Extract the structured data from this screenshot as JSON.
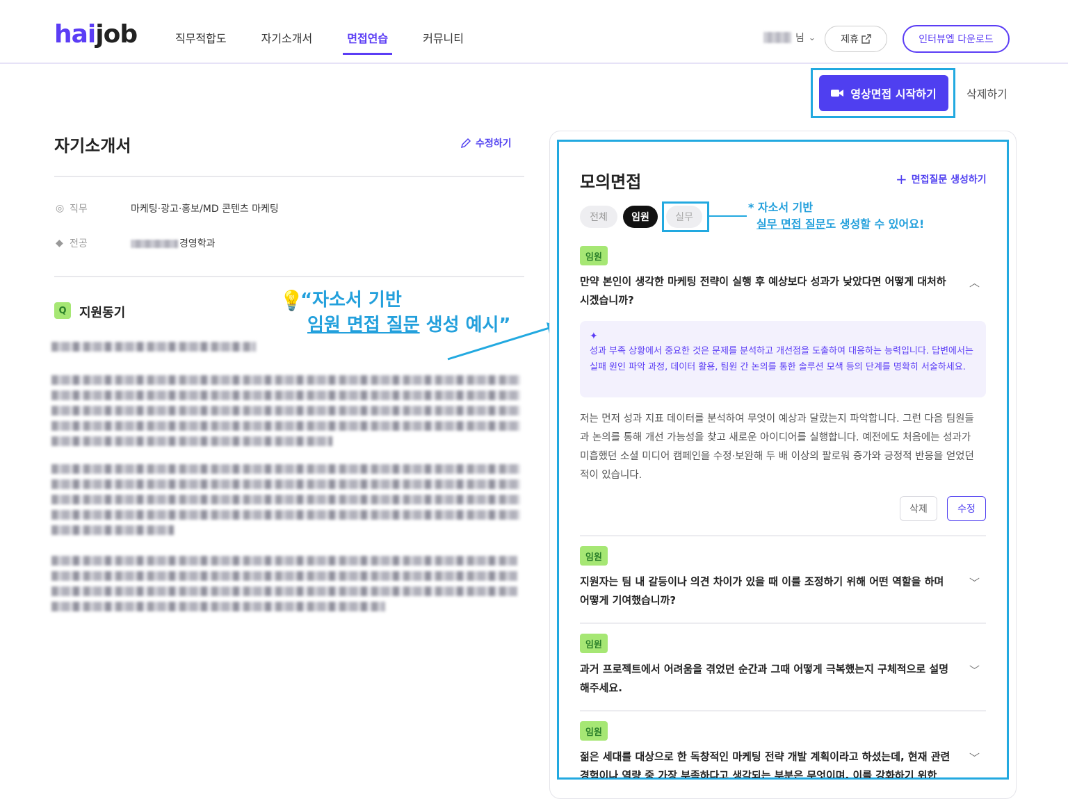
{
  "header": {
    "logo_hai": "hai",
    "logo_job": "job",
    "nav": [
      {
        "label": "직무적합도",
        "active": false
      },
      {
        "label": "자기소개서",
        "active": false
      },
      {
        "label": "면접연습",
        "active": true
      },
      {
        "label": "커뮤니티",
        "active": false
      }
    ],
    "user_suffix": "님",
    "partner_label": "제휴",
    "download_label": "인터뷰엡 다운로드"
  },
  "actions": {
    "start_video_label": "영상면접 시작하기",
    "delete_label": "삭제하기"
  },
  "cover_letter": {
    "title": "자기소개서",
    "edit_label": "수정하기",
    "job_label": "직무",
    "job_value": "마케팅·광고·홍보/MD 콘텐츠 마케팅",
    "major_label": "전공",
    "major_value": "경영학과",
    "section_badge": "Q",
    "section_title": "지원동기"
  },
  "annotation": {
    "quote_line1": "“자소서 기반",
    "quote_line2_underlined": "임원 면접 질문",
    "quote_line2_rest": " 생성 예시”",
    "side_line1": "* 자소서 기반",
    "side_line2_underlined": "실무 면접 질문",
    "side_line2_rest": "도 생성할 수 있어요!"
  },
  "mock_interview": {
    "title": "모의면접",
    "generate_label": "면접질문 생성하기",
    "filters": [
      "전체",
      "임원",
      "실무"
    ],
    "questions": [
      {
        "tag": "임원",
        "text": "만약 본인이 생각한 마케팅 전략이 실행 후 예상보다 성과가 낮았다면 어떻게 대처하시겠습니까?",
        "expanded": true,
        "tip": "성과 부족 상황에서 중요한 것은 문제를 분석하고 개선점을 도출하여 대응하는 능력입니다. 답변에서는 실패 원인 파악 과정, 데이터 활용, 팀원 간 논의를 통한 솔루션 모색 등의 단계를 명확히 서술하세요.",
        "answer": "저는 먼저 성과 지표 데이터를 분석하여 무엇이 예상과 달랐는지 파악합니다. 그런 다음 팀원들과 논의를 통해 개선 가능성을 찾고 새로운 아이디어를 실행합니다. 예전에도 처음에는 성과가 미흡했던 소셜 미디어 캠페인을 수정·보완해 두 배 이상의 팔로워 증가와 긍정적 반응을 얻었던 적이 있습니다.",
        "delete_label": "삭제",
        "edit_label": "수정"
      },
      {
        "tag": "임원",
        "text": "지원자는 팀 내 갈등이나 의견 차이가 있을 때 이를 조정하기 위해 어떤 역할을 하며 어떻게 기여했습니까?",
        "expanded": false
      },
      {
        "tag": "임원",
        "text": "과거 프로젝트에서 어려움을 겪었던 순간과 그때 어떻게 극복했는지 구체적으로 설명해주세요.",
        "expanded": false
      },
      {
        "tag": "임원",
        "text": "젊은 세대를 대상으로 한 독창적인 마케팅 전략 개발 계획이라고 하셨는데, 현재 관련 경험이나 역량 중 가장 부족하다고 생각되는 부분은 무엇이며, 이를 강화하기 위한",
        "expanded": false
      }
    ]
  },
  "colors": {
    "brand": "#5b3df5",
    "annotation": "#22a9e0",
    "tag_bg": "#a6e774"
  }
}
